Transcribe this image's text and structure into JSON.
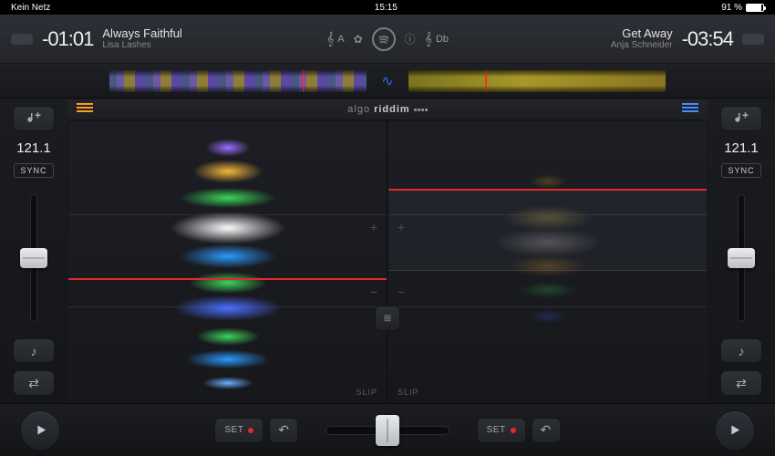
{
  "status": {
    "left": "Kein Netz",
    "time": "15:15",
    "battery_pct": "91 %"
  },
  "deck_a": {
    "time": "-01:01",
    "title": "Always Faithful",
    "artist": "Lisa Lashes",
    "key": "A",
    "bpm": "121.1",
    "sync": "SYNC",
    "slip": "SLIP",
    "set": "SET"
  },
  "deck_b": {
    "time": "-03:54",
    "title": "Get Away",
    "artist": "Anja Schneider",
    "key": "Db",
    "bpm": "121.1",
    "sync": "SYNC",
    "slip": "SLIP",
    "set": "SET"
  },
  "brand": {
    "pre": "algo",
    "bold": "riddim"
  }
}
